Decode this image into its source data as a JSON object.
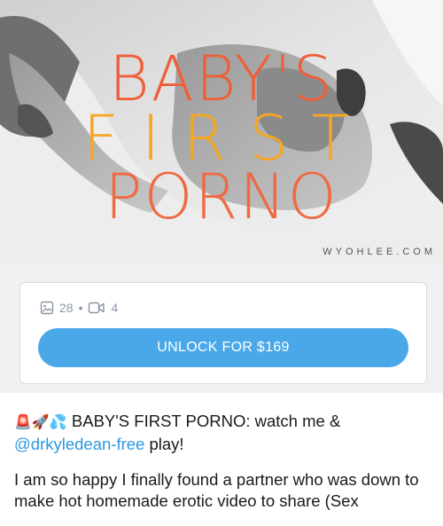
{
  "cover": {
    "title_line1": "BABY'S",
    "title_line2": "FIRST",
    "title_line3": "PORNO",
    "watermark": "WYOHLEE.COM"
  },
  "locked_post": {
    "image_count": "28",
    "separator": "•",
    "video_count": "4",
    "unlock_label": "UNLOCK FOR $169"
  },
  "post": {
    "emojis": "🚨🚀💦",
    "title_text": " BABY'S FIRST PORNO: watch me &",
    "mention": "@drkyledean-free",
    "after_mention": " play!",
    "body": "I am so happy I finally found a partner who was down to make hot homemade erotic video to share (Sex"
  },
  "colors": {
    "accent": "#4aa8e8",
    "mention": "#2d97e3",
    "muted": "#8a96a3"
  }
}
